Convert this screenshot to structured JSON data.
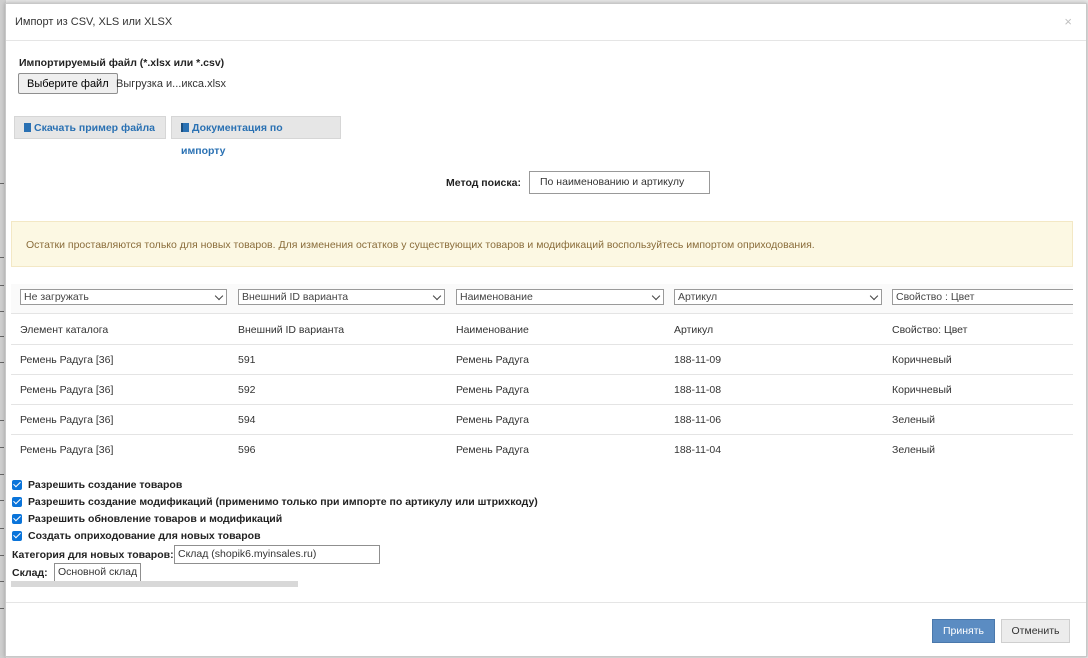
{
  "dialog": {
    "title": "Импорт из CSV, XLS или XLSX",
    "close_symbol": "×"
  },
  "file": {
    "label": "Импортируемый файл (*.xlsx или *.csv)",
    "button_label": "Выберите файл",
    "file_name": "Выгрузка и...икса.xlsx"
  },
  "links": {
    "download_example": "Скачать пример файла",
    "documentation": "Документация по импорту"
  },
  "search": {
    "label": "Метод поиска:",
    "value": "По наименованию и артикулу"
  },
  "alert": {
    "text": "Остатки проставляются только для новых товаров. Для изменения остатков у существующих товаров и модификаций воспользуйтесь импортом оприходования."
  },
  "table": {
    "column_selects": [
      "Не загружать",
      "Внешний ID варианта",
      "Наименование",
      "Артикул",
      "Свойство : Цвет"
    ],
    "headers": [
      "Элемент каталога",
      "Внешний ID варианта",
      "Наименование",
      "Артикул",
      "Свойство: Цвет"
    ],
    "rows": [
      [
        "Ремень Радуга [36]",
        "591",
        "Ремень Радуга",
        "188-11-09",
        "Коричневый"
      ],
      [
        "Ремень Радуга [36]",
        "592",
        "Ремень Радуга",
        "188-11-08",
        "Коричневый"
      ],
      [
        "Ремень Радуга [36]",
        "594",
        "Ремень Радуга",
        "188-11-06",
        "Зеленый"
      ],
      [
        "Ремень Радуга [36]",
        "596",
        "Ремень Радуга",
        "188-11-04",
        "Зеленый"
      ]
    ]
  },
  "options": {
    "allow_create_products": "Разрешить создание товаров",
    "allow_create_modifications": "Разрешить создание модификаций (применимо только при импорте по артикулу или штрихкоду)",
    "allow_update": "Разрешить обновление товаров и модификаций",
    "create_receipt": "Создать оприходование для новых товаров"
  },
  "category": {
    "label": "Категория для новых товаров:",
    "value": "Склад (shopik6.myinsales.ru)"
  },
  "warehouse": {
    "label": "Склад:",
    "value": "Основной склад"
  },
  "footer": {
    "accept": "Принять",
    "cancel": "Отменить"
  },
  "colors": {
    "accent": "#2a71b3",
    "primary_button": "#5b8cc2",
    "alert_bg": "#fcf8e3",
    "alert_text": "#8a6d3b",
    "checkbox": "#0a74da"
  },
  "icons": {
    "download_example": "file-icon",
    "documentation": "book-icon"
  }
}
